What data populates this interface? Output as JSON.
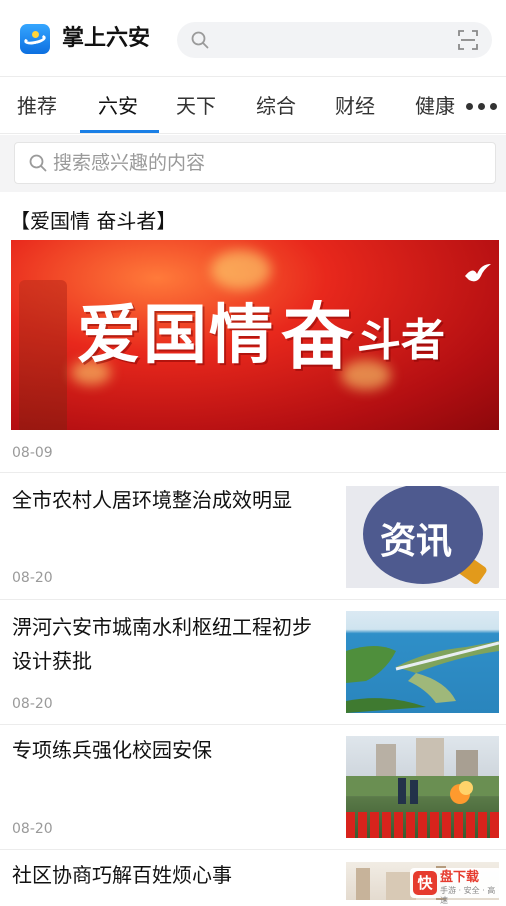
{
  "header": {
    "app_title": "掌上六安",
    "search_placeholder": ""
  },
  "tabs": [
    {
      "label": "推荐",
      "active": false
    },
    {
      "label": "六安",
      "active": true
    },
    {
      "label": "天下",
      "active": false
    },
    {
      "label": "综合",
      "active": false
    },
    {
      "label": "财经",
      "active": false
    },
    {
      "label": "健康",
      "active": false
    }
  ],
  "sub_search": {
    "placeholder": "搜索感兴趣的内容"
  },
  "feature": {
    "title": "【爱国情 奋斗者】",
    "banner_text_1": "爱国情",
    "banner_text_2": "奋",
    "banner_text_3": "斗者",
    "date": "08-09"
  },
  "news": [
    {
      "title": "全市农村人居环境整治成效明显",
      "date": "08-20",
      "thumb_label": "资讯"
    },
    {
      "title": "淠河六安市城南水利枢纽工程初步设计获批",
      "date": "08-20",
      "thumb_label": ""
    },
    {
      "title": "专项练兵强化校园安保",
      "date": "08-20",
      "thumb_label": ""
    },
    {
      "title": "社区协商巧解百姓烦心事",
      "date": "",
      "thumb_label": ""
    }
  ],
  "watermark": {
    "badge": "快",
    "text": "盘下载",
    "sub": "手游 · 安全 · 高速"
  },
  "colors": {
    "accent": "#1a7fe6",
    "banner_red": "#d91f18"
  }
}
